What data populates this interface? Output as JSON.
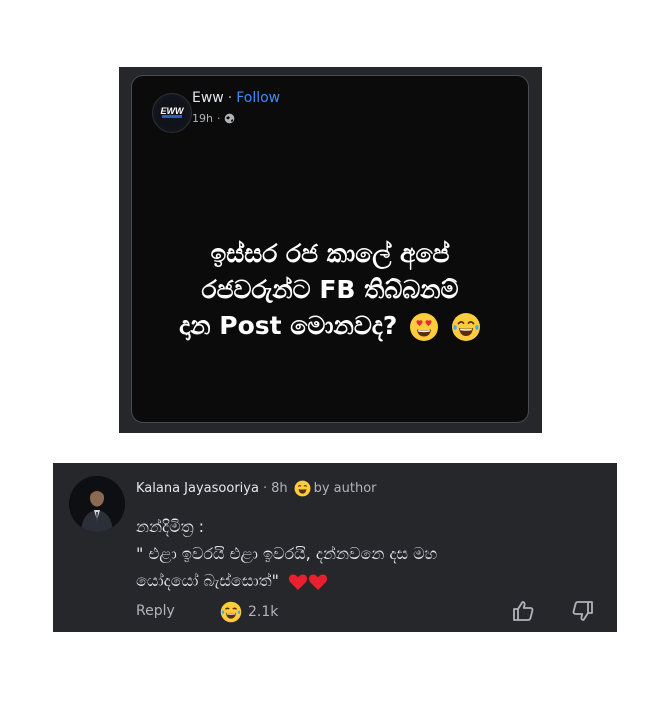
{
  "post": {
    "page_name": "Eww",
    "follow_label": "Follow",
    "avatar_text": "EWW",
    "time": "19h",
    "privacy_icon": "globe-icon",
    "text_lines": [
      "ඉස්සර රජ කාලේ අපේ",
      "රජවරුන්ට FB තිබ්බනම්",
      "දාන Post මොනවද?"
    ],
    "emojis": [
      "heart-eyes-icon",
      "laughing-tears-icon"
    ]
  },
  "comment": {
    "author": "Kalana Jayasooriya",
    "time": "8h",
    "badge_label": "by author",
    "lines": [
      "නන්දිමිත්‍ර :",
      "\" එළා ඉවරයි එළා ඉවරයි, දන්නවනෙ දස මහ",
      "යෝදයෝ බැස්සොත්\""
    ],
    "hearts": [
      "red-heart-icon",
      "red-heart-icon"
    ],
    "reply_label": "Reply",
    "reaction_count": "2.1k",
    "reaction_icon": "laughing-icon",
    "colors": {
      "background": "#26272b",
      "text": "#e4e6eb",
      "muted": "#b0b3b8",
      "link": "#3d8bfd"
    }
  }
}
